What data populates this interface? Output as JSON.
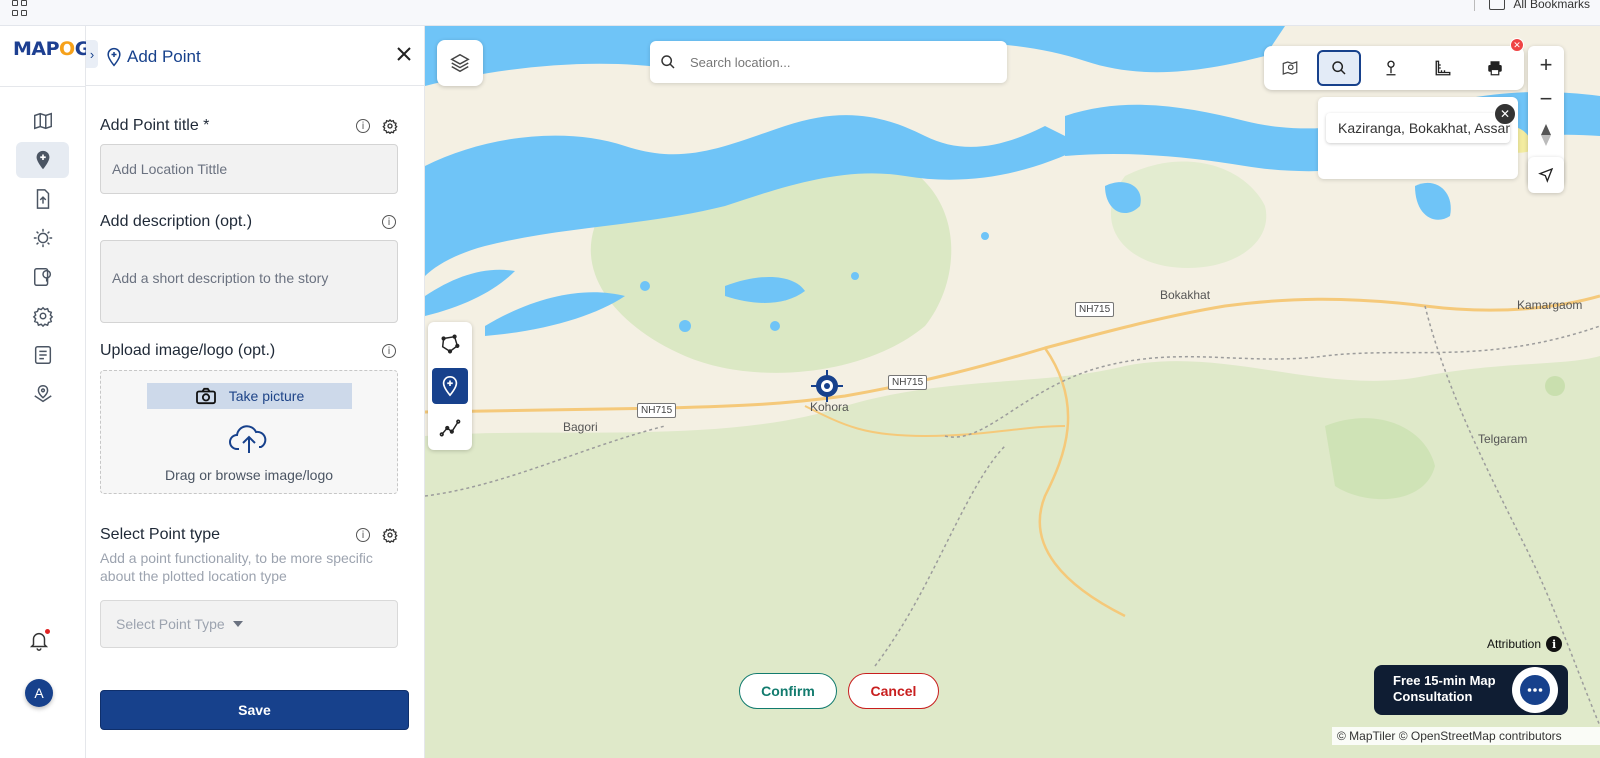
{
  "browser": {
    "bookmarks_label": "All Bookmarks"
  },
  "app": {
    "logo_text_left": "MAP",
    "logo_text_accent": "O",
    "logo_text_right": "G",
    "avatar_initial": "A"
  },
  "sidebar": {
    "items": [
      {
        "icon": "map-icon"
      },
      {
        "icon": "location-pin-icon",
        "active": true
      },
      {
        "icon": "upload-file-icon"
      },
      {
        "icon": "settings-sun-icon"
      },
      {
        "icon": "map-pin-settings-icon"
      },
      {
        "icon": "gear-icon"
      },
      {
        "icon": "report-icon"
      },
      {
        "icon": "map-location-icon"
      }
    ],
    "bottom": [
      "bell-icon",
      "avatar"
    ]
  },
  "panel": {
    "title": "Add Point",
    "title_label": "Add Point title *",
    "title_placeholder": "Add Location Tittle",
    "description_label": "Add description (opt.)",
    "description_placeholder": "Add a short description to the story",
    "upload_label": "Upload image/logo (opt.)",
    "take_picture": "Take picture",
    "drag_text": "Drag or browse image/logo",
    "point_type_label": "Select Point type",
    "point_type_help": "Add a point functionality, to be more specific about the plotted location type",
    "point_type_placeholder": "Select Point Type",
    "save_label": "Save"
  },
  "map": {
    "search_placeholder": "Search location...",
    "search_result": "Kaziranga, Bokakhat, Assam",
    "labels": [
      {
        "text": "Bokakhat"
      },
      {
        "text": "Kamargaom"
      },
      {
        "text": "Kohora"
      },
      {
        "text": "Bagori"
      },
      {
        "text": "Telgaram"
      }
    ],
    "road_shields": [
      "NH715",
      "NH715",
      "NH715"
    ],
    "confirm_label": "Confirm",
    "cancel_label": "Cancel",
    "attribution_label": "Attribution",
    "attribution_icon": "i",
    "consult_line1": "Free 15-min Map",
    "consult_line2": "Consultation",
    "copyright": "© MapTiler © OpenStreetMap contributors",
    "colors": {
      "water": "#6fc4f7",
      "land": "#f4f0e3",
      "forest": "#dbe9c6",
      "road": "#f5c97a",
      "accent": "#17418c"
    }
  }
}
